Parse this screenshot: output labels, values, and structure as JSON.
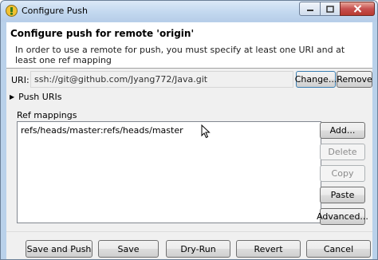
{
  "window": {
    "title": "Configure Push",
    "icon": "git-push-icon",
    "controls": {
      "minimize": "minimize-icon",
      "maximize": "maximize-icon",
      "close": "close-icon"
    }
  },
  "header": {
    "title": "Configure push for remote 'origin'",
    "description": "In order to use a remote for push, you must specify at least one URI and at least one ref mapping"
  },
  "uri": {
    "label": "URI:",
    "value": "ssh://git@github.com/Jyang772/Java.git",
    "change_label": "Change...",
    "remove_label": "Remove"
  },
  "push_uris": {
    "label": "Push URIs",
    "expanded": false
  },
  "ref_mappings": {
    "label": "Ref mappings",
    "items": [
      "refs/heads/master:refs/heads/master"
    ],
    "buttons": {
      "add": "Add...",
      "delete": "Delete",
      "copy": "Copy",
      "paste": "Paste",
      "advanced": "Advanced..."
    }
  },
  "footer": {
    "save_and_push": "Save and Push",
    "save": "Save",
    "dry_run": "Dry-Run",
    "revert": "Revert",
    "cancel": "Cancel"
  },
  "colors": {
    "titlebar": "#c3d8ef",
    "close_button": "#c75050",
    "default_button_border": "#3c7fb1"
  }
}
